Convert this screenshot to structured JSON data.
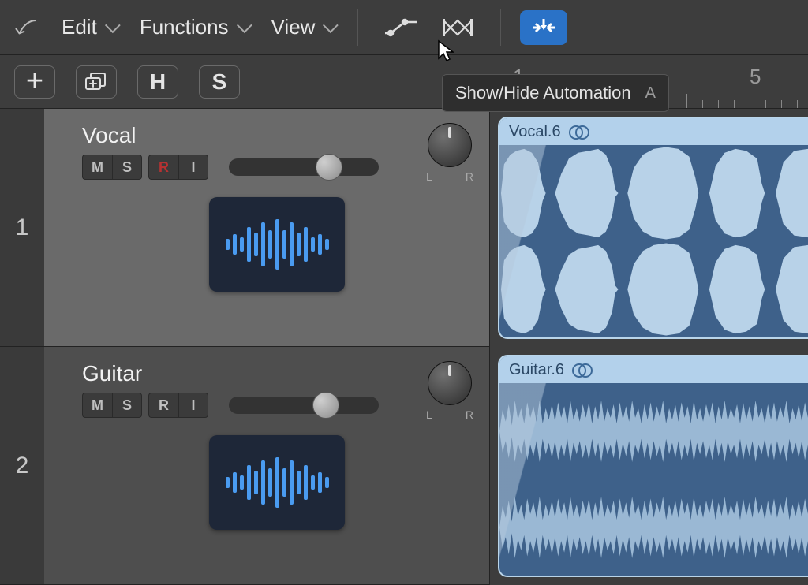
{
  "toolbar": {
    "menus": {
      "edit": "Edit",
      "functions": "Functions",
      "view": "View"
    }
  },
  "tooltip": {
    "text": "Show/Hide Automation",
    "shortcut": "A"
  },
  "ruler": {
    "marks": [
      "1",
      "5"
    ]
  },
  "secondary": {
    "hide": "H",
    "solo": "S"
  },
  "tracks": [
    {
      "number": "1",
      "name": "Vocal",
      "selected": true,
      "buttons": {
        "mute": "M",
        "solo": "S",
        "record": "R",
        "input": "I"
      },
      "region_name": "Vocal.6",
      "pan": {
        "left": "L",
        "right": "R"
      }
    },
    {
      "number": "2",
      "name": "Guitar",
      "selected": false,
      "buttons": {
        "mute": "M",
        "solo": "S",
        "record": "R",
        "input": "I"
      },
      "region_name": "Guitar.6",
      "pan": {
        "left": "L",
        "right": "R"
      }
    }
  ]
}
